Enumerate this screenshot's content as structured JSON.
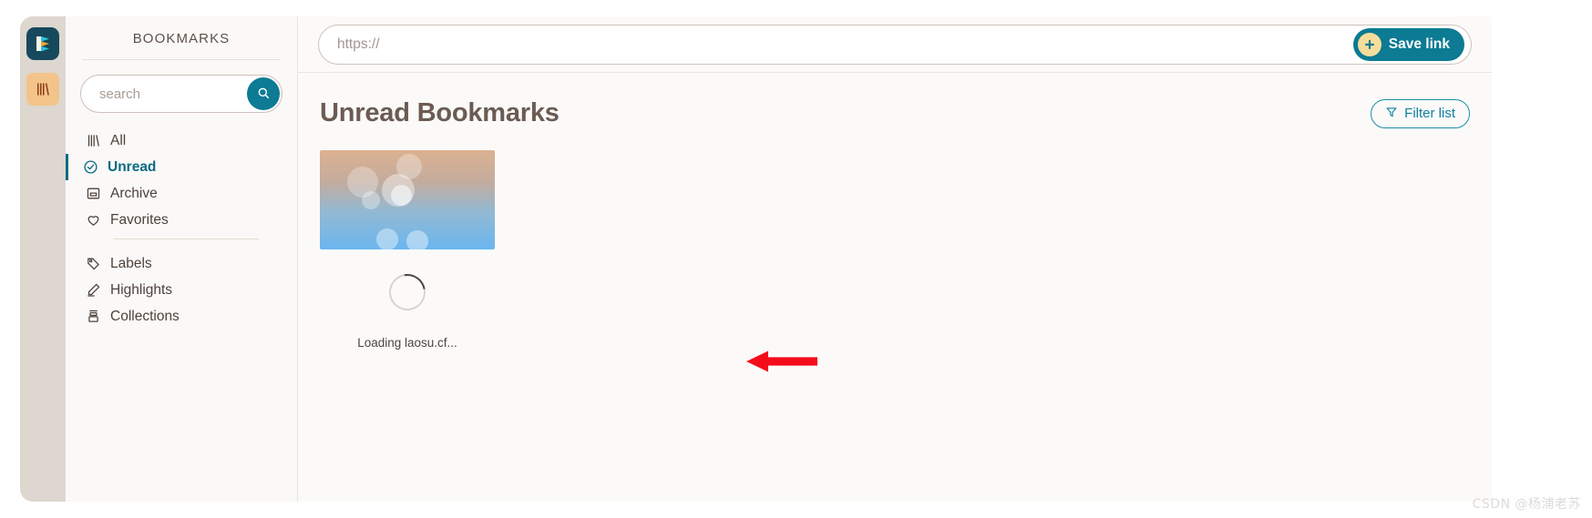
{
  "app": {
    "logo_icon": "readeck-logo-icon",
    "rail_tile_icon": "books-icon"
  },
  "sidebar": {
    "title": "BOOKMARKS",
    "search": {
      "placeholder": "search",
      "value": "",
      "button_icon": "search-icon"
    },
    "groups": [
      {
        "items": [
          {
            "label": "All",
            "icon": "books-icon",
            "active": false
          },
          {
            "label": "Unread",
            "icon": "check-circle-icon",
            "active": true
          },
          {
            "label": "Archive",
            "icon": "archive-box-icon",
            "active": false
          },
          {
            "label": "Favorites",
            "icon": "heart-icon",
            "active": false
          }
        ]
      },
      {
        "items": [
          {
            "label": "Labels",
            "icon": "tag-icon",
            "active": false
          },
          {
            "label": "Highlights",
            "icon": "highlighter-pen-icon",
            "active": false
          },
          {
            "label": "Collections",
            "icon": "collections-stack-icon",
            "active": false
          }
        ]
      }
    ]
  },
  "topbar": {
    "url_placeholder": "https://",
    "url_value": "",
    "save_label": "Save link",
    "save_icon": "plus-icon"
  },
  "main": {
    "page_title": "Unread Bookmarks",
    "filter_label": "Filter list",
    "filter_icon": "funnel-icon",
    "cards": [
      {
        "loading_text": "Loading laosu.cf...",
        "state": "loading",
        "thumbnail": "gradient-bubbles-placeholder"
      }
    ]
  },
  "annotation": {
    "arrow_icon": "red-left-arrow-icon",
    "arrow_color": "#f50c1a"
  },
  "watermark": "CSDN @杨浦老苏",
  "colors": {
    "accent_teal": "#0c7b93",
    "rail_bg": "#ddd7cf",
    "tile_orange": "#f3c48a",
    "title_brown": "#6b5b52",
    "plus_badge": "#f6dd9c"
  }
}
